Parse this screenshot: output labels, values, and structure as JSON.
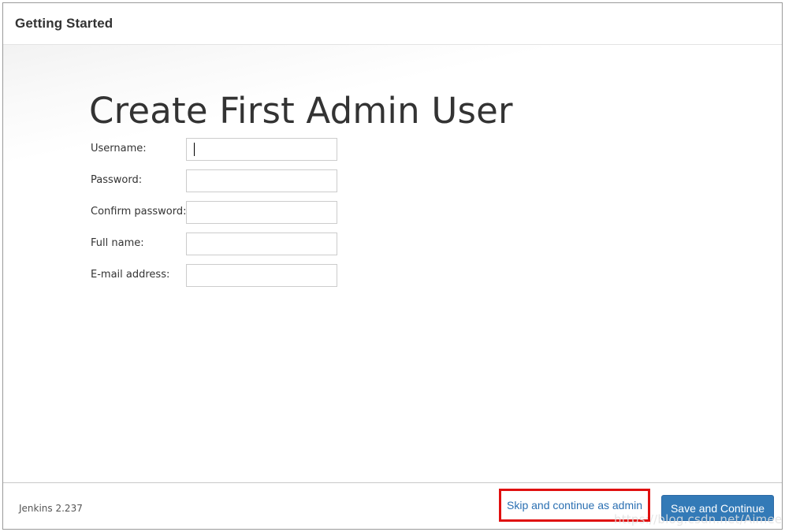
{
  "header": {
    "title": "Getting Started"
  },
  "main": {
    "title": "Create First Admin User",
    "fields": [
      {
        "label": "Username:",
        "value": "",
        "focused": true
      },
      {
        "label": "Password:",
        "value": ""
      },
      {
        "label": "Confirm password:",
        "value": ""
      },
      {
        "label": "Full name:",
        "value": ""
      },
      {
        "label": "E-mail address:",
        "value": ""
      }
    ]
  },
  "footer": {
    "version": "Jenkins 2.237",
    "skip_label": "Skip and continue as admin",
    "save_label": "Save and Continue",
    "watermark": "https://blog.csdn.net/Aimee_c"
  },
  "colors": {
    "primary_button": "#337ab7",
    "link": "#2a6fb2",
    "highlight_box": "#e01010"
  }
}
